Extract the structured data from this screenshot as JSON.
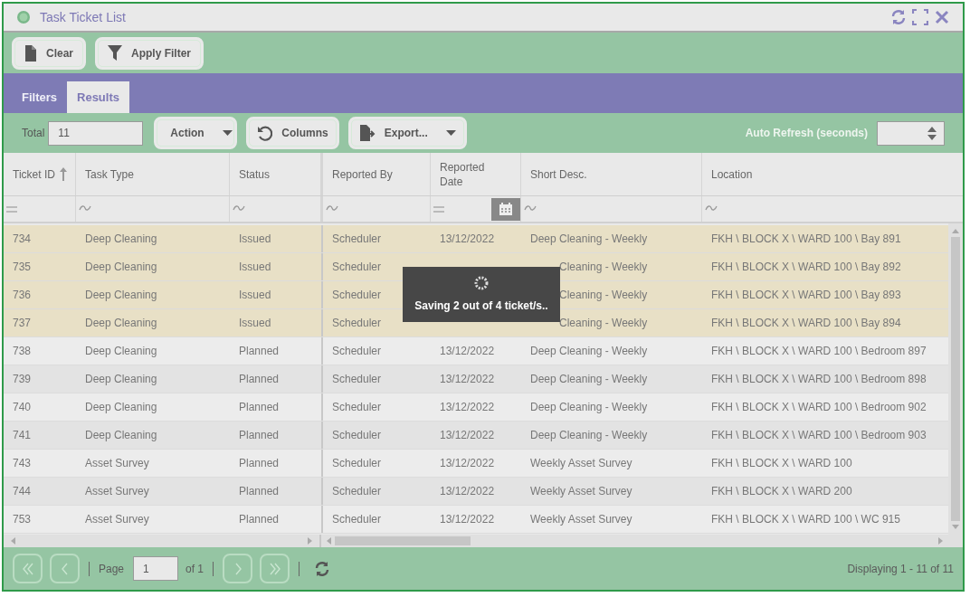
{
  "window": {
    "title": "Task Ticket List"
  },
  "toolbar": {
    "buttons": [
      {
        "kind": "clear",
        "label": "Clear"
      },
      {
        "kind": "filter",
        "label": "Apply Filter"
      }
    ]
  },
  "tabs": [
    {
      "label": "Filters",
      "selected": false
    },
    {
      "label": "Results",
      "selected": true
    }
  ],
  "results_toolbar": {
    "total_label": "Total",
    "total_value": "11",
    "buttons": [
      {
        "kind": "dropdown",
        "label": "Action"
      },
      {
        "kind": "reset",
        "label": "Columns"
      },
      {
        "kind": "export",
        "label": "Export..."
      }
    ],
    "auto_refresh_label": "Auto Refresh (seconds)"
  },
  "table": {
    "columns": [
      {
        "label": "Ticket ID",
        "sorted": true,
        "filter": {
          "kind": "equals"
        }
      },
      {
        "label": "Task Type",
        "sorted": false,
        "filter": {
          "kind": "like"
        }
      },
      {
        "label": "Status",
        "sorted": false,
        "filter": {
          "kind": "like"
        }
      },
      {
        "label": "Reported By",
        "sorted": false,
        "filter": {
          "kind": "like"
        }
      },
      {
        "label": "Reported Date",
        "sorted": false,
        "filter": {
          "kind": "date"
        }
      },
      {
        "label": "Short Desc.",
        "sorted": false,
        "filter": {
          "kind": "like"
        }
      },
      {
        "label": "Location",
        "sorted": false,
        "filter": {
          "kind": "like"
        }
      }
    ],
    "rows": [
      {
        "highlighted": true,
        "partly_covered": false,
        "cells": [
          "734",
          "Deep Cleaning",
          "Issued",
          "Scheduler",
          "13/12/2022",
          "Deep Cleaning - Weekly",
          "FKH \\ BLOCK X \\ WARD 100 \\ Bay 891"
        ]
      },
      {
        "highlighted": true,
        "partly_covered": true,
        "cells": [
          "735",
          "Deep Cleaning",
          "Issued",
          "Scheduler",
          null,
          "Cleaning - Weekly",
          "FKH \\ BLOCK X \\ WARD 100 \\ Bay 892"
        ]
      },
      {
        "highlighted": true,
        "partly_covered": true,
        "cells": [
          "736",
          "Deep Cleaning",
          "Issued",
          "Scheduler",
          null,
          "Cleaning - Weekly",
          "FKH \\ BLOCK X \\ WARD 100 \\ Bay 893"
        ]
      },
      {
        "highlighted": true,
        "partly_covered": true,
        "cells": [
          "737",
          "Deep Cleaning",
          "Issued",
          "Scheduler",
          null,
          "Cleaning - Weekly",
          "FKH \\ BLOCK X \\ WARD 100 \\ Bay 894"
        ]
      },
      {
        "highlighted": false,
        "cells": [
          "738",
          "Deep Cleaning",
          "Planned",
          "Scheduler",
          "13/12/2022",
          "Deep Cleaning - Weekly",
          "FKH \\ BLOCK X \\ WARD 100 \\ Bedroom 897"
        ]
      },
      {
        "highlighted": false,
        "cells": [
          "739",
          "Deep Cleaning",
          "Planned",
          "Scheduler",
          "13/12/2022",
          "Deep Cleaning - Weekly",
          "FKH \\ BLOCK X \\ WARD 100 \\ Bedroom 898"
        ]
      },
      {
        "highlighted": false,
        "cells": [
          "740",
          "Deep Cleaning",
          "Planned",
          "Scheduler",
          "13/12/2022",
          "Deep Cleaning - Weekly",
          "FKH \\ BLOCK X \\ WARD 100 \\ Bedroom 902"
        ]
      },
      {
        "highlighted": false,
        "cells": [
          "741",
          "Deep Cleaning",
          "Planned",
          "Scheduler",
          "13/12/2022",
          "Deep Cleaning - Weekly",
          "FKH \\ BLOCK X \\ WARD 100 \\ Bedroom 903"
        ]
      },
      {
        "highlighted": false,
        "cells": [
          "743",
          "Asset Survey",
          "Planned",
          "Scheduler",
          "13/12/2022",
          "Weekly Asset Survey",
          "FKH \\ BLOCK X \\ WARD 100"
        ]
      },
      {
        "highlighted": false,
        "cells": [
          "744",
          "Asset Survey",
          "Planned",
          "Scheduler",
          "13/12/2022",
          "Weekly Asset Survey",
          "FKH \\ BLOCK X \\ WARD 200"
        ]
      },
      {
        "highlighted": false,
        "cells": [
          "753",
          "Asset Survey",
          "Planned",
          "Scheduler",
          "13/12/2022",
          "Weekly Asset Survey",
          "FKH \\ BLOCK X \\ WARD 100 \\ WC 915"
        ]
      }
    ]
  },
  "loading_overlay": {
    "message": "Saving 2 out of 4 ticket/s.."
  },
  "pager": {
    "page_label": "Page",
    "page_value": "1",
    "of_label": "of 1",
    "display": "Displaying 1 - 11 of 11"
  }
}
